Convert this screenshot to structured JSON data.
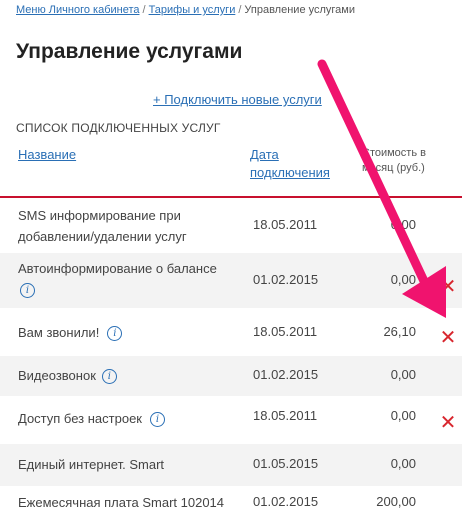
{
  "breadcrumb": {
    "items": [
      "Меню Личного кабинета",
      "Тарифы и услуги"
    ],
    "separator": "/",
    "current": "Управление услугами"
  },
  "page_title": "Управление услугами",
  "connect_link": "+ Подключить новые услуги",
  "list_heading": "СПИСОК ПОДКЛЮЧЕННЫХ УСЛУГ",
  "columns": {
    "name": "Название",
    "date_line1": "Дата",
    "date_line2": "подключения",
    "cost_line1": "Стоимость в",
    "cost_line2": "месяц (руб.)"
  },
  "rows": [
    {
      "name_line1": "SMS информирование при",
      "name_line2": "добавлении/удалении услуг",
      "date": "18.05.2011",
      "cost": "0,00"
    },
    {
      "name_line1": "Автоинформирование о балансе",
      "date": "01.02.2015",
      "cost": "0,00",
      "info": true,
      "deletable": true
    },
    {
      "name_line1": "Вам звонили!",
      "date": "18.05.2011",
      "cost": "26,10",
      "info": true,
      "deletable": true
    },
    {
      "name_line1": "Видеозвонок",
      "date": "01.02.2015",
      "cost": "0,00",
      "info": true
    },
    {
      "name_line1": "Доступ без настроек",
      "date": "18.05.2011",
      "cost": "0,00",
      "info": true,
      "deletable": true
    },
    {
      "name_line1": "Единый интернет. Smart",
      "date": "01.05.2015",
      "cost": "0,00"
    },
    {
      "name_line1": "Ежемесячная плата Smart 102014",
      "date": "01.02.2015",
      "cost": "200,00"
    }
  ],
  "icons": {
    "info": "i",
    "delete": "✕"
  },
  "colors": {
    "link": "#2a6fb5",
    "rule": "#c8102e",
    "arrow": "#f0136e",
    "delete": "#d8262e"
  }
}
